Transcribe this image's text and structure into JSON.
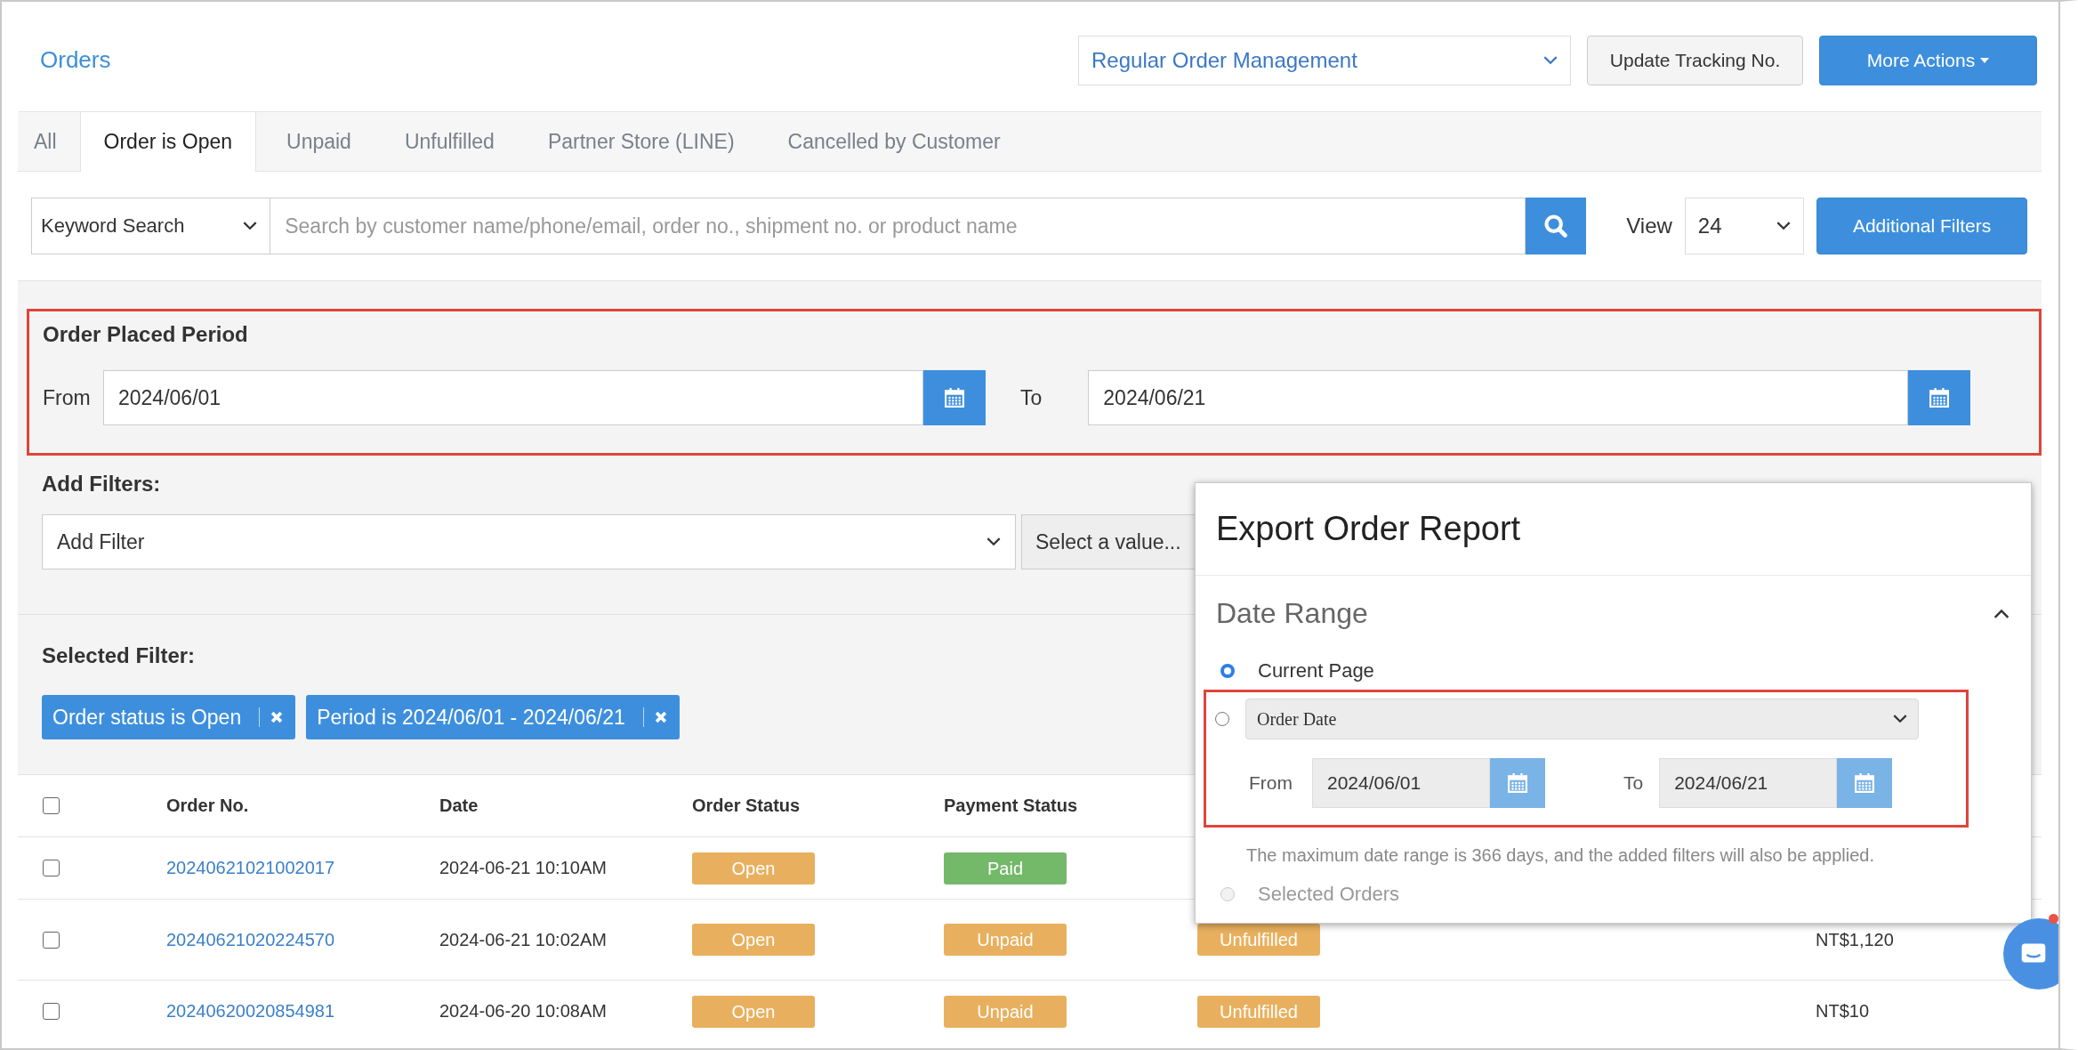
{
  "header": {
    "title": "Orders",
    "view_select": "Regular Order Management",
    "buttons": [
      {
        "label": "Update Tracking No.",
        "kind": "default"
      },
      {
        "label": "More Actions",
        "kind": "primary"
      }
    ]
  },
  "tabs": [
    {
      "label": "All",
      "selected": false
    },
    {
      "label": "Order is Open",
      "selected": true
    },
    {
      "label": "Unpaid",
      "selected": false
    },
    {
      "label": "Unfulfilled",
      "selected": false
    },
    {
      "label": "Partner Store (LINE)",
      "selected": false
    },
    {
      "label": "Cancelled by Customer",
      "selected": false
    }
  ],
  "search": {
    "type_select": "Keyword Search",
    "placeholder": "Search by customer name/phone/email, order no., shipment no. or product name",
    "view_label": "View",
    "view_count": "24",
    "filters_button": "Additional Filters"
  },
  "order_period": {
    "title": "Order Placed Period",
    "from_label": "From",
    "from": "2024/06/01",
    "to_label": "To",
    "to": "2024/06/21"
  },
  "add_filters": {
    "title": "Add Filters:",
    "filter_select": "Add Filter",
    "value_select": "Select a value..."
  },
  "selected_filters": {
    "title": "Selected Filter:",
    "chips": [
      "Order status is Open",
      "Period is 2024/06/01 - 2024/06/21"
    ]
  },
  "table": {
    "select_all_checked": false,
    "columns": [
      "Order No.",
      "Date",
      "Order Status",
      "Payment Status"
    ],
    "rows": [
      {
        "checked": false,
        "order_no": "20240621021002017",
        "date": "2024-06-21 10:10AM",
        "order_status": "Open",
        "payment_status": {
          "label": "Paid",
          "kind": "paid"
        }
      },
      {
        "checked": false,
        "order_no": "20240621020224570",
        "date": "2024-06-21 10:02AM",
        "order_status": "Open",
        "payment_status": {
          "label": "Unpaid",
          "kind": "unpaid"
        },
        "fulfillment": "Unfulfilled",
        "total": "NT$1,120"
      },
      {
        "checked": false,
        "order_no": "20240620020854981",
        "date": "2024-06-20 10:08AM",
        "order_status": "Open",
        "payment_status": {
          "label": "Unpaid",
          "kind": "unpaid"
        },
        "fulfillment": "Unfulfilled",
        "total": "NT$10"
      }
    ]
  },
  "export_dialog": {
    "title": "Export Order Report",
    "section": "Date Range",
    "expanded": true,
    "options": [
      {
        "kind": "plain",
        "label": "Current Page",
        "selected": true,
        "disabled": false
      },
      {
        "kind": "date_range",
        "select": "Order Date",
        "from_label": "From",
        "from": "2024/06/01",
        "to_label": "To",
        "to": "2024/06/21",
        "note": "The maximum date range is 366 days, and the added filters will also be applied.",
        "selected": false,
        "disabled": false
      },
      {
        "kind": "plain",
        "label": "Selected Orders",
        "selected": false,
        "disabled": true
      }
    ]
  },
  "chat": {
    "unread": true
  }
}
